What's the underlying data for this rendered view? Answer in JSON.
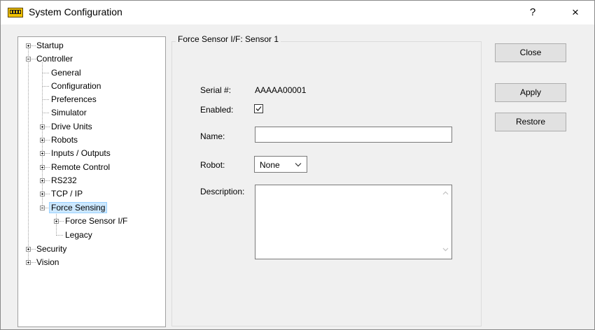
{
  "window": {
    "title": "System Configuration",
    "help_label": "?",
    "close_label": "×"
  },
  "tree": {
    "items": [
      {
        "label": "Startup"
      },
      {
        "label": "Controller"
      },
      {
        "label": "General"
      },
      {
        "label": "Configuration"
      },
      {
        "label": "Preferences"
      },
      {
        "label": "Simulator"
      },
      {
        "label": "Drive Units"
      },
      {
        "label": "Robots"
      },
      {
        "label": "Inputs / Outputs"
      },
      {
        "label": "Remote Control"
      },
      {
        "label": "RS232"
      },
      {
        "label": "TCP / IP"
      },
      {
        "label": "Force Sensing"
      },
      {
        "label": "Force Sensor I/F"
      },
      {
        "label": "Legacy"
      },
      {
        "label": "Security"
      },
      {
        "label": "Vision"
      }
    ],
    "selected": "Force Sensing"
  },
  "panel": {
    "group_title": "Force Sensor I/F: Sensor 1",
    "serial_label": "Serial #:",
    "serial_value": "AAAAA00001",
    "enabled_label": "Enabled:",
    "enabled_checked": true,
    "name_label": "Name:",
    "name_value": "",
    "robot_label": "Robot:",
    "robot_value": "None",
    "description_label": "Description:",
    "description_value": ""
  },
  "buttons": {
    "close": "Close",
    "apply": "Apply",
    "restore": "Restore"
  },
  "colors": {
    "title_bar": "#ffffff",
    "window_bg": "#f0f0f0",
    "button_bg": "#e1e1e1",
    "selection": "#cce8ff",
    "app_icon": "#f2c200"
  }
}
